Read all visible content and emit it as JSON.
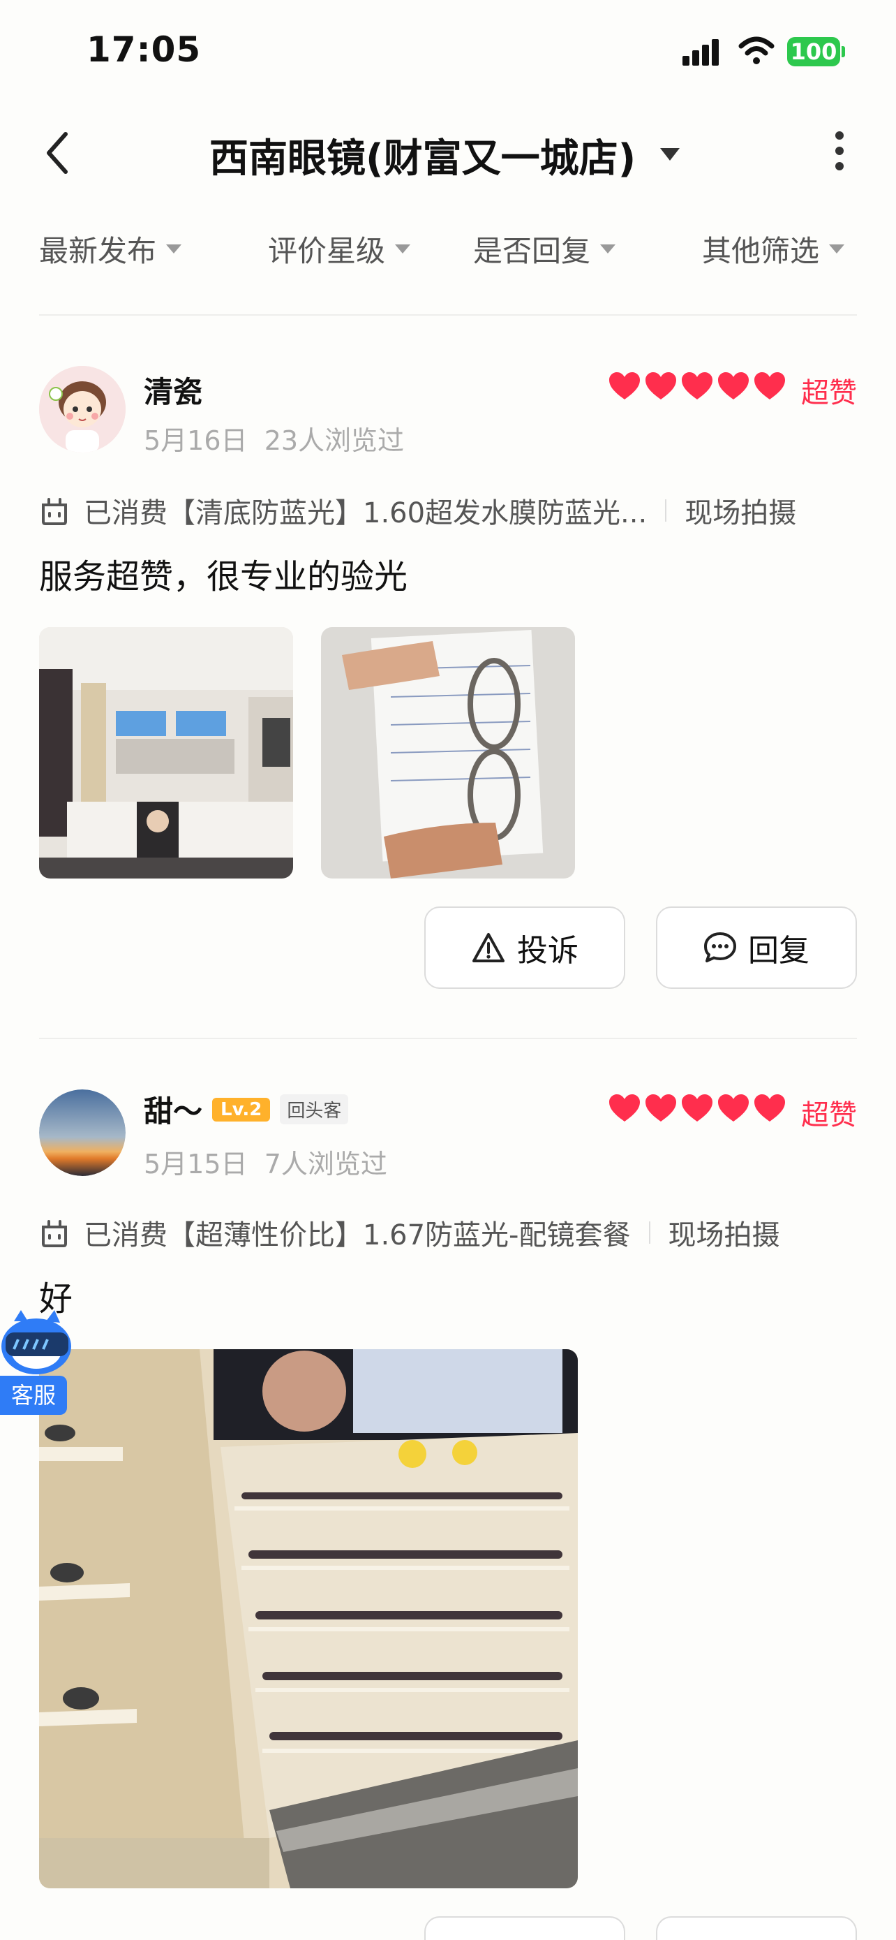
{
  "status_bar": {
    "time": "17:05",
    "battery": "100"
  },
  "header": {
    "title": "西南眼镜(财富又一城店)"
  },
  "filters": [
    {
      "label": "最新发布"
    },
    {
      "label": "评价星级"
    },
    {
      "label": "是否回复"
    },
    {
      "label": "其他筛选"
    }
  ],
  "reviews": [
    {
      "username": "清瓷",
      "date": "5月16日",
      "views": "23人浏览过",
      "rating": 5,
      "rating_label": "超赞",
      "purchase": "已消费【清底防蓝光】1.60超发水膜防蓝光...",
      "tag": "现场拍摄",
      "content": "服务超赞，很专业的验光",
      "actions": {
        "complain": "投诉",
        "reply": "回复"
      }
    },
    {
      "username": "甜～",
      "level": "Lv.2",
      "badge": "回头客",
      "date": "5月15日",
      "views": "7人浏览过",
      "rating": 5,
      "rating_label": "超赞",
      "purchase": "已消费【超薄性价比】1.67防蓝光-配镜套餐",
      "tag": "现场拍摄",
      "content": "好"
    }
  ],
  "customer_service": {
    "label": "客服"
  },
  "colors": {
    "accent": "#ff2e4d",
    "battery": "#2dc84d",
    "level_badge": "#ffb12b",
    "cs_button": "#2f7cf6"
  }
}
